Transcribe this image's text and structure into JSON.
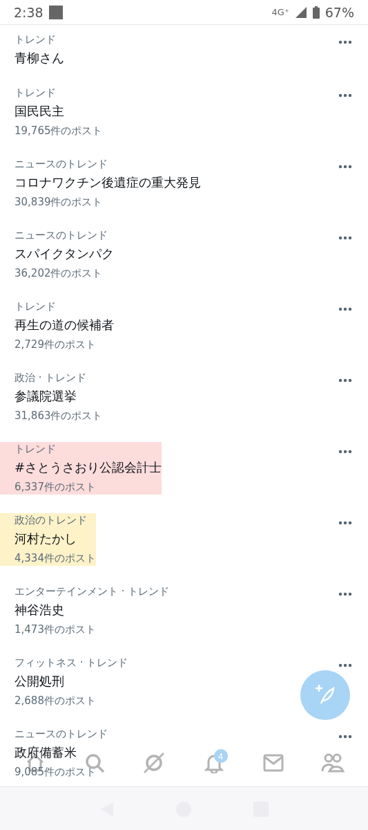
{
  "status_bar": {
    "time": "2:38",
    "network": "4G⁺",
    "battery": "67%"
  },
  "trends": [
    {
      "category": "トレンド",
      "title": "青柳さん"
    },
    {
      "category": "トレンド",
      "title": "国民民主",
      "count": "19,765件のポスト"
    },
    {
      "category": "ニュースのトレンド",
      "title": "コロナワクチン後遺症の重大発見",
      "count": "30,839件のポスト"
    },
    {
      "category": "ニュースのトレンド",
      "title": "スパイクタンパク",
      "count": "36,202件のポスト"
    },
    {
      "category": "トレンド",
      "title": "再生の道の候補者",
      "count": "2,729件のポスト"
    },
    {
      "category": "政治 · トレンド",
      "title": "参議院選挙",
      "count": "31,863件のポスト"
    },
    {
      "category": "トレンド",
      "title": "#さとうさおり公認会計士",
      "count": "6,337件のポスト",
      "color": "#fddcdc"
    },
    {
      "category": "政治のトレンド",
      "title": "河村たかし",
      "count": "4,334件のポスト",
      "color": "#fdf2c8"
    },
    {
      "category": "エンターテインメント · トレンド",
      "title": "神谷浩史",
      "count": "1,473件のポスト"
    },
    {
      "category": "フィットネス · トレンド",
      "title": "公開処刑",
      "count": "2,688件のポスト"
    },
    {
      "category": "ニュースのトレンド",
      "title": "政府備蓄米",
      "count": "9,085件のポスト"
    }
  ],
  "tab_bar": {
    "notification_badge": "4"
  }
}
